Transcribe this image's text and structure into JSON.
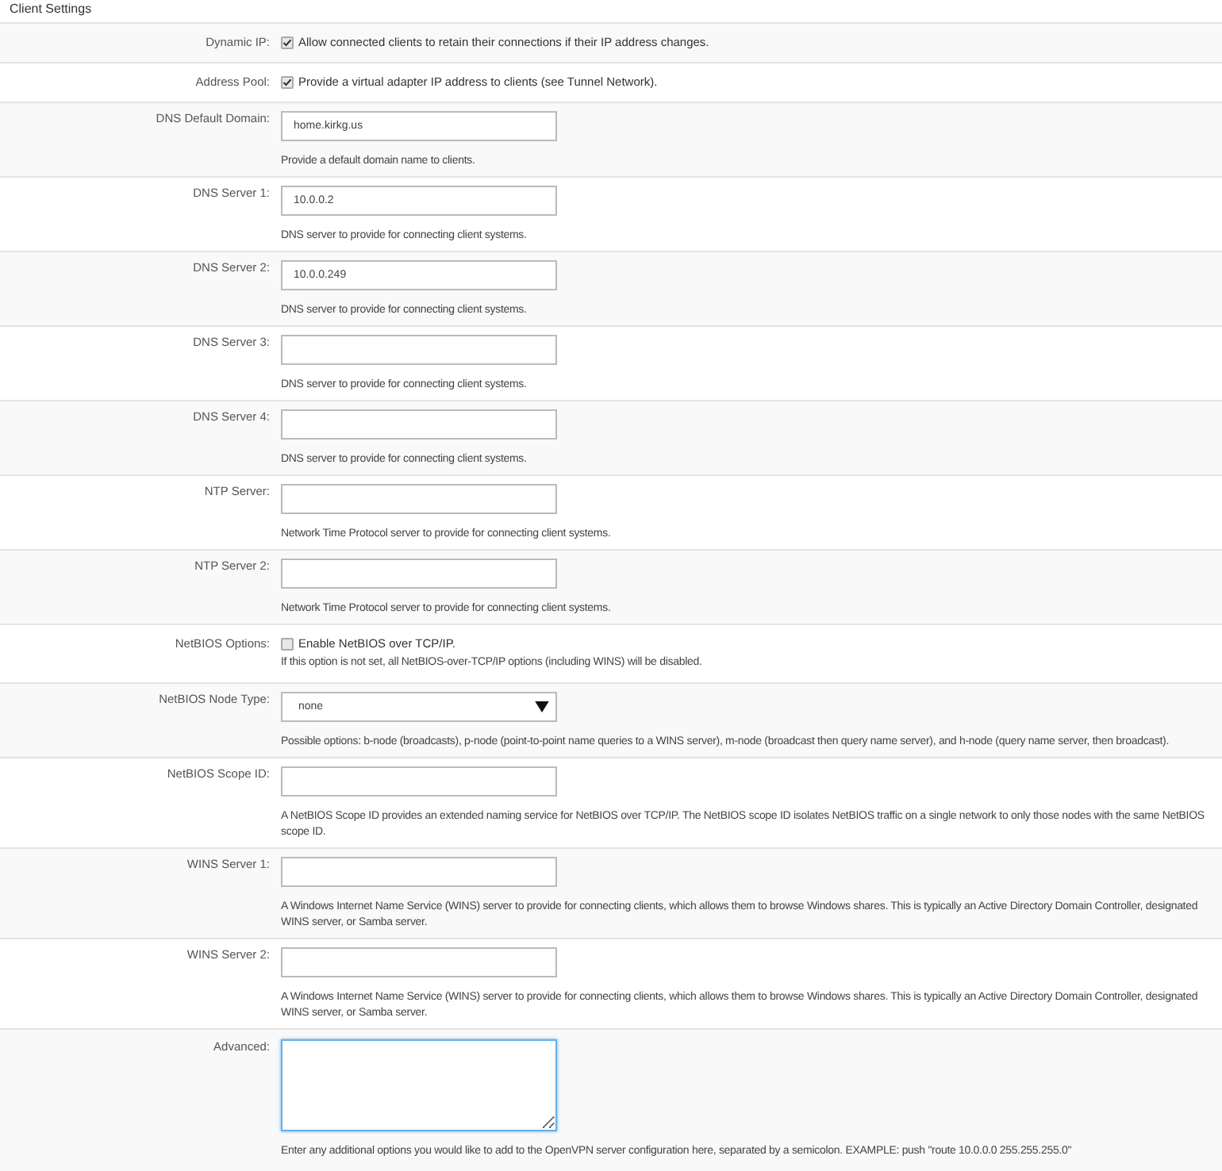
{
  "section": {
    "title": "Client Settings"
  },
  "rows": [
    {
      "kind": "checkbox",
      "label": "Dynamic IP:",
      "checked": true,
      "text": "Allow connected clients to retain their connections if their IP address changes."
    },
    {
      "kind": "checkbox",
      "label": "Address Pool:",
      "checked": true,
      "text": "Provide a virtual adapter IP address to clients (see Tunnel Network)."
    },
    {
      "kind": "input",
      "label": "DNS Default Domain:",
      "value": "home.kirkg.us",
      "help": "Provide a default domain name to clients."
    },
    {
      "kind": "input",
      "label": "DNS Server 1:",
      "value": "10.0.0.2",
      "help": "DNS server to provide for connecting client systems."
    },
    {
      "kind": "input",
      "label": "DNS Server 2:",
      "value": "10.0.0.249",
      "help": "DNS server to provide for connecting client systems."
    },
    {
      "kind": "input",
      "label": "DNS Server 3:",
      "help": "DNS server to provide for connecting client systems."
    },
    {
      "kind": "input",
      "label": "DNS Server 4:",
      "help": "DNS server to provide for connecting client systems."
    },
    {
      "kind": "input",
      "label": "NTP Server:",
      "help": "Network Time Protocol server to provide for connecting client systems."
    },
    {
      "kind": "input",
      "label": "NTP Server 2:",
      "help": "Network Time Protocol server to provide for connecting client systems."
    },
    {
      "kind": "checkbox",
      "label": "NetBIOS Options:",
      "checked": false,
      "text": "Enable NetBIOS over TCP/IP.",
      "help": "If this option is not set, all NetBIOS-over-TCP/IP options (including WINS) will be disabled."
    },
    {
      "kind": "select",
      "label": "NetBIOS Node Type:",
      "value": "none",
      "help": "Possible options: b-node (broadcasts), p-node (point-to-point name queries to a WINS server), m-node (broadcast then query name server), and h-node (query name server, then broadcast)."
    },
    {
      "kind": "input",
      "label": "NetBIOS Scope ID:",
      "help": "A NetBIOS Scope ID provides an extended naming service for NetBIOS over TCP/IP. The NetBIOS scope ID isolates NetBIOS traffic on a single network to only those nodes with the same NetBIOS scope ID."
    },
    {
      "kind": "input",
      "label": "WINS Server 1:",
      "help": "A Windows Internet Name Service (WINS) server to provide for connecting clients, which allows them to browse Windows shares. This is typically an Active Directory Domain Controller, designated WINS server, or Samba server."
    },
    {
      "kind": "input",
      "label": "WINS Server 2:",
      "help": "A Windows Internet Name Service (WINS) server to provide for connecting clients, which allows them to browse Windows shares. This is typically an Active Directory Domain Controller, designated WINS server, or Samba server."
    },
    {
      "kind": "textarea",
      "label": "Advanced:",
      "focused": true,
      "help": "Enter any additional options you would like to add to the OpenVPN server configuration here, separated by a semicolon. EXAMPLE: push \"route 10.0.0.0 255.255.255.0\""
    }
  ]
}
